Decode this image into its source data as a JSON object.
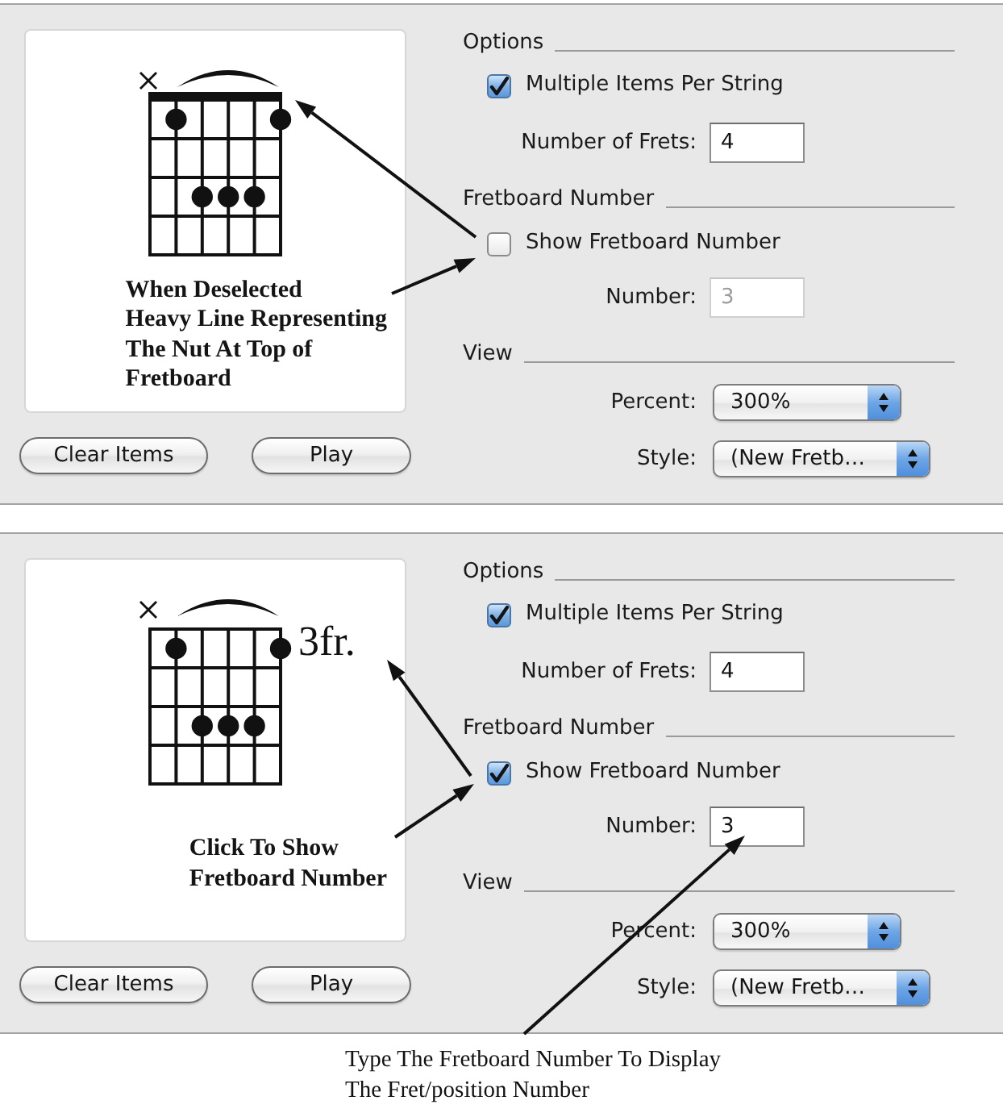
{
  "panels": [
    {
      "preview": {
        "note_lines": [
          "When Deselected",
          "Heavy Line Representing",
          "The Nut At Top of",
          "Fretboard"
        ]
      },
      "buttons": [
        {
          "label": "Clear Items"
        },
        {
          "label": "Play"
        }
      ],
      "options": {
        "title": "Options",
        "multiple_items": {
          "label": "Multiple Items Per String",
          "checked": true
        },
        "frets": {
          "label": "Number of Frets:",
          "value": "4"
        }
      },
      "fretboard_number": {
        "title": "Fretboard Number",
        "show": {
          "label": "Show Fretboard Number",
          "checked": false
        },
        "number": {
          "label": "Number:",
          "value": "3",
          "disabled": true
        }
      },
      "view": {
        "title": "View",
        "percent": {
          "label": "Percent:",
          "value": "300%"
        },
        "style": {
          "label": "Style:",
          "value": "(New Fretb…"
        }
      }
    },
    {
      "preview": {
        "fret_label": "3fr.",
        "note_lines": [
          "Click To Show",
          "Fretboard Number"
        ]
      },
      "buttons": [
        {
          "label": "Clear Items"
        },
        {
          "label": "Play"
        }
      ],
      "options": {
        "title": "Options",
        "multiple_items": {
          "label": "Multiple Items Per String",
          "checked": true
        },
        "frets": {
          "label": "Number of Frets:",
          "value": "4"
        }
      },
      "fretboard_number": {
        "title": "Fretboard Number",
        "show": {
          "label": "Show Fretboard Number",
          "checked": true
        },
        "number": {
          "label": "Number:",
          "value": "3",
          "disabled": false
        }
      },
      "view": {
        "title": "View",
        "percent": {
          "label": "Percent:",
          "value": "300%"
        },
        "style": {
          "label": "Style:",
          "value": "(New Fretb…"
        }
      }
    }
  ],
  "caption": {
    "lines": [
      "Type The Fretboard Number To Display",
      "The Fret/position Number"
    ]
  }
}
